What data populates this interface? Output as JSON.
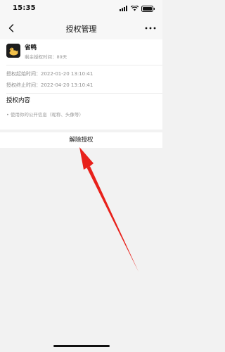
{
  "status_bar": {
    "time": "15:35"
  },
  "nav": {
    "title": "授权管理",
    "back_icon": "chevron-left-icon",
    "more_icon": "more-dots-icon"
  },
  "app": {
    "name": "省鸭",
    "remaining": "剩余授权时间：89天",
    "logo_icon": "duck-logo-icon"
  },
  "auth_times": {
    "start_label": "授权起始时间：",
    "start_value": "2022-01-20 13:10:41",
    "end_label": "授权终止时间：",
    "end_value": "2022-04-20 13:10:41"
  },
  "scope": {
    "title": "授权内容",
    "item": "• 使用你的公开信息（昵称、头像等）"
  },
  "revoke_button": {
    "label": "解除授权"
  },
  "annotation": {
    "arrow_color": "#e8211b"
  }
}
